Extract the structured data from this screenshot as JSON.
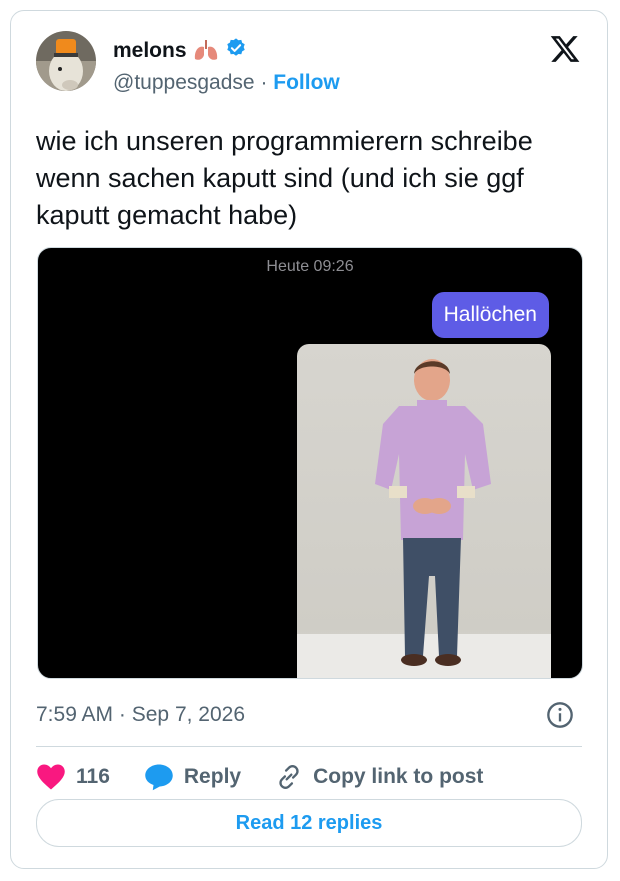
{
  "author": {
    "name": "melons",
    "handle": "@tuppesgadse",
    "separator": "·",
    "follow_label": "Follow"
  },
  "tweet": {
    "text": "wie ich unseren programmierern schreibe wenn sachen kaputt sind (und ich sie ggf kaputt gemacht habe)",
    "time": "7:59 AM",
    "date_separator": "·",
    "date": "Sep 7, 2026"
  },
  "media": {
    "chat_timestamp": "Heute 09:26",
    "bubble_text": "Hallöchen"
  },
  "actions": {
    "likes": "116",
    "reply_label": "Reply",
    "copy_label": "Copy link to post"
  },
  "read_replies_label": "Read 12 replies",
  "colors": {
    "accent": "#1d9bf0",
    "like": "#f91880",
    "bubble": "#5e5ce6"
  },
  "icons": [
    "avatar",
    "lungs-emoji-icon",
    "verified-icon",
    "x-logo-icon",
    "info-icon",
    "heart-icon",
    "reply-icon",
    "link-icon"
  ]
}
